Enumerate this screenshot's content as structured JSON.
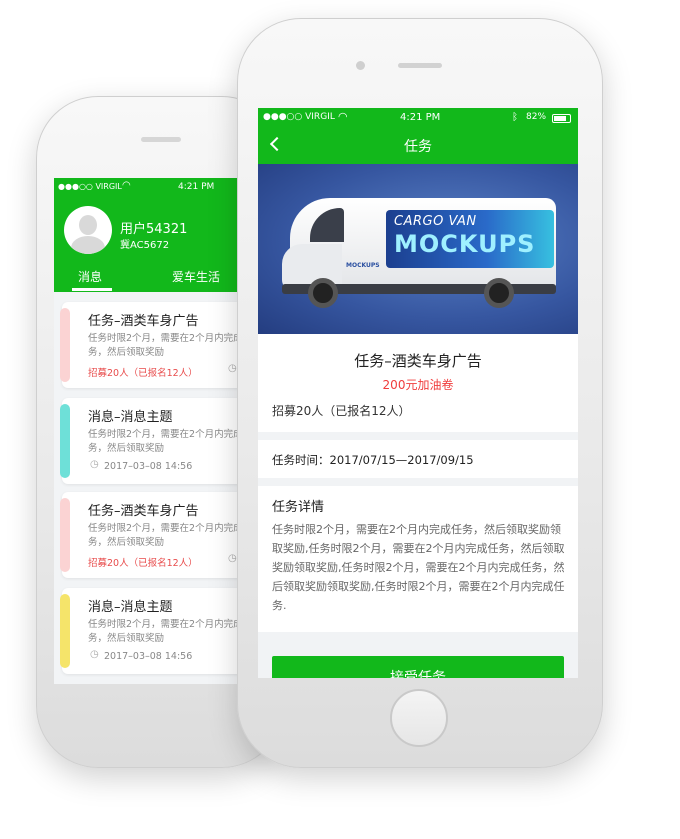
{
  "colors": {
    "accent": "#12b81b",
    "red": "#f03c3c",
    "gray_bg": "#f1f3f5"
  },
  "back_phone": {
    "status": {
      "carrier": "●●●○○ VIRGIL",
      "time": "4:21 PM"
    },
    "user": {
      "name": "用户54321",
      "plate": "冀AC5672"
    },
    "tabs": [
      {
        "label": "消息"
      },
      {
        "label": "爱车生活"
      }
    ],
    "cards": [
      {
        "title": "任务–酒类车身广告",
        "desc": "任务时限2个月，需要在2个月内完成任务，然后领取奖励",
        "footer": "招募20人（已报名12人）",
        "footer_type": "recruit",
        "clock": "2",
        "bar_color": "#fbd3d3"
      },
      {
        "title": "消息–消息主题",
        "desc": "任务时限2个月，需要在2个月内完成任务，然后领取奖励",
        "footer": "2017–03–08  14:56",
        "footer_type": "date",
        "clock": "",
        "bar_color": "#6ee0d8"
      },
      {
        "title": "任务–酒类车身广告",
        "desc": "任务时限2个月，需要在2个月内完成任务，然后领取奖励",
        "footer": "招募20人（已报名12人）",
        "footer_type": "recruit",
        "clock": "2",
        "bar_color": "#fbd3d3"
      },
      {
        "title": "消息–消息主题",
        "desc": "任务时限2个月，需要在2个月内完成任务，然后领取奖励",
        "footer": "2017–03–08  14:56",
        "footer_type": "date",
        "clock": "",
        "bar_color": "#f5e46a"
      }
    ]
  },
  "front_phone": {
    "status": {
      "carrier": "●●●○○ VIRGIL",
      "time": "4:21 PM",
      "battery": "82%"
    },
    "nav": {
      "title": "任务",
      "back_icon": "chevron-left-icon"
    },
    "banner": {
      "line1": "CARGO VAN",
      "line2": "MOCKUPS",
      "van_label": "MOCKUPS"
    },
    "task": {
      "title": "任务–酒类车身广告",
      "reward": "200元加油卷",
      "recruit": "招募20人（已报名12人）"
    },
    "time": {
      "label": "任务时间：",
      "range": "2017/07/15—2017/09/15"
    },
    "detail": {
      "heading": "任务详情",
      "body": "任务时限2个月，需要在2个月内完成任务，然后领取奖励领取奖励,任务时限2个月，需要在2个月内完成任务，然后领取奖励领取奖励,任务时限2个月，需要在2个月内完成任务，然后领取奖励领取奖励,任务时限2个月，需要在2个月内完成任务."
    },
    "accept_button": "接受任务"
  }
}
